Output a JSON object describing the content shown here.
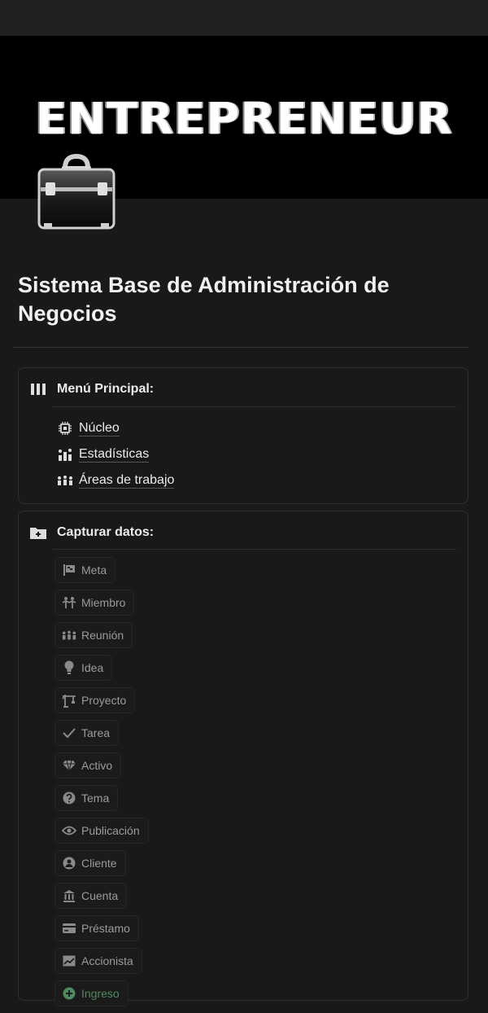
{
  "cover": {
    "title": "ENTREPRENEUR"
  },
  "page": {
    "title": "Sistema Base de Administración de Negocios"
  },
  "menu": {
    "heading": "Menú Principal:",
    "items": [
      {
        "label": "Núcleo",
        "icon": "chip-icon"
      },
      {
        "label": "Estadísticas",
        "icon": "stats-icon"
      },
      {
        "label": "Áreas de trabajo",
        "icon": "people-icon"
      }
    ]
  },
  "capture": {
    "heading": "Capturar datos:",
    "buttons": [
      {
        "label": "Meta",
        "icon": "flag-icon"
      },
      {
        "label": "Miembro",
        "icon": "members-icon"
      },
      {
        "label": "Reunión",
        "icon": "meeting-icon"
      },
      {
        "label": "Idea",
        "icon": "lightbulb-icon"
      },
      {
        "label": "Proyecto",
        "icon": "crane-icon"
      },
      {
        "label": "Tarea",
        "icon": "check-icon"
      },
      {
        "label": "Activo",
        "icon": "diamond-icon"
      },
      {
        "label": "Tema",
        "icon": "question-icon"
      },
      {
        "label": "Publicación",
        "icon": "eye-icon"
      },
      {
        "label": "Cliente",
        "icon": "user-icon"
      },
      {
        "label": "Cuenta",
        "icon": "bank-icon"
      },
      {
        "label": "Préstamo",
        "icon": "card-icon"
      },
      {
        "label": "Accionista",
        "icon": "chart-icon"
      },
      {
        "label": "Ingreso",
        "icon": "plus-circle-icon"
      }
    ]
  },
  "colors": {
    "background": "#191919",
    "text": "#e9e9e7",
    "muted": "#9b9b98",
    "green": "#4e8a5e"
  }
}
